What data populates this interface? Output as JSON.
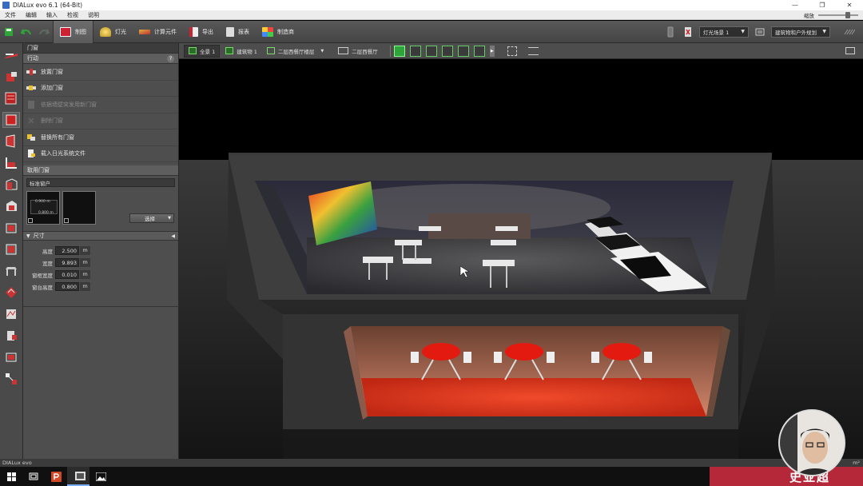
{
  "window": {
    "title": "DIALux evo 6.1  (64-Bit)",
    "controls": [
      "—",
      "❐",
      "✕"
    ]
  },
  "menu": {
    "items": [
      "文件",
      "编辑",
      "输入",
      "检视",
      "说明"
    ],
    "zoom_label": "缩放"
  },
  "toolbar": {
    "modes": [
      {
        "label": "制图",
        "active": true
      },
      {
        "label": "灯光"
      },
      {
        "label": "计算元件"
      },
      {
        "label": "导出"
      },
      {
        "label": "报表"
      },
      {
        "label": "制造商"
      }
    ],
    "light_scene": "灯光场景 1",
    "planning": "建筑物和户外规划"
  },
  "panel": {
    "header": "门窗",
    "actions_title": "行动",
    "help": "?",
    "actions": [
      {
        "label": "放置门窗",
        "enabled": true
      },
      {
        "label": "添加门窗",
        "enabled": true
      },
      {
        "label": "依据墙壁突发用新门窗",
        "enabled": false
      },
      {
        "label": "删除门窗",
        "enabled": false
      },
      {
        "label": "替换所有门窗",
        "enabled": true
      },
      {
        "label": "载入日光系统文件",
        "enabled": true
      }
    ],
    "applied_title": "取用门窗",
    "applied_value": "标准窗户",
    "preview_dim1": "0.900 m",
    "preview_dim2": "0.800 m",
    "select_label": "选择",
    "dims_title": "尺寸",
    "dims": [
      {
        "label": "高度",
        "value": "2.500",
        "unit": "m"
      },
      {
        "label": "宽度",
        "value": "9.893",
        "unit": "m"
      },
      {
        "label": "窗框宽度",
        "value": "0.010",
        "unit": "m"
      },
      {
        "label": "窗台高度",
        "value": "0.800",
        "unit": "m"
      }
    ]
  },
  "viewbar": {
    "items": [
      {
        "label": "全景 1",
        "active": true
      },
      {
        "label": "建筑物 1"
      },
      {
        "label": "二层西餐厅楼层"
      },
      {
        "label": "二层西餐厅"
      }
    ]
  },
  "status": {
    "app": "DIALux evo",
    "unit": "m²"
  },
  "watermark": {
    "name": "史亚超"
  },
  "colors": {
    "accent_green": "#2fa43a",
    "watermark_red": "#b42839",
    "floor_red": "#e0301e"
  }
}
